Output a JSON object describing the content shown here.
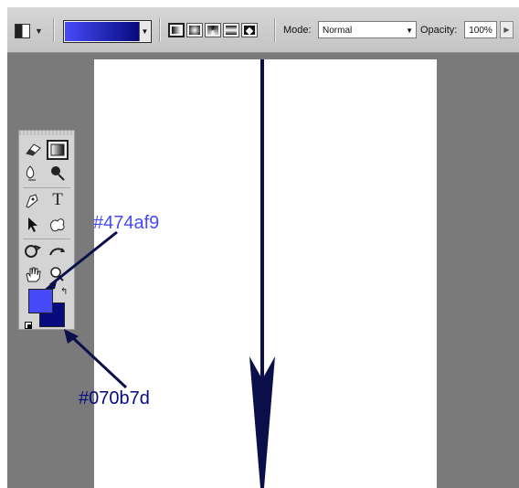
{
  "options_bar": {
    "mode_label": "Mode:",
    "mode_value": "Normal",
    "opacity_label": "Opacity:",
    "opacity_value": "100%",
    "gradient_start_color": "#070b7d",
    "gradient_end_color": "#474af9",
    "gradient_types": [
      "linear-gradient-icon",
      "radial-gradient-icon",
      "angle-gradient-icon",
      "reflected-gradient-icon",
      "diamond-gradient-icon"
    ]
  },
  "tools": {
    "foreground_color": "#474af9",
    "background_color": "#070b7d",
    "icons": [
      "eraser-icon",
      "gradient-icon",
      "blur-icon",
      "dodge-icon",
      "pen-icon",
      "type-icon",
      "path-selection-icon",
      "custom-shape-icon",
      "3d-rotate-icon",
      "3d-orbit-icon",
      "hand-icon",
      "zoom-icon"
    ]
  },
  "annotations": {
    "foreground_label": "#474af9",
    "background_label": "#070b7d",
    "arrow_color": "#0a0f4a"
  }
}
